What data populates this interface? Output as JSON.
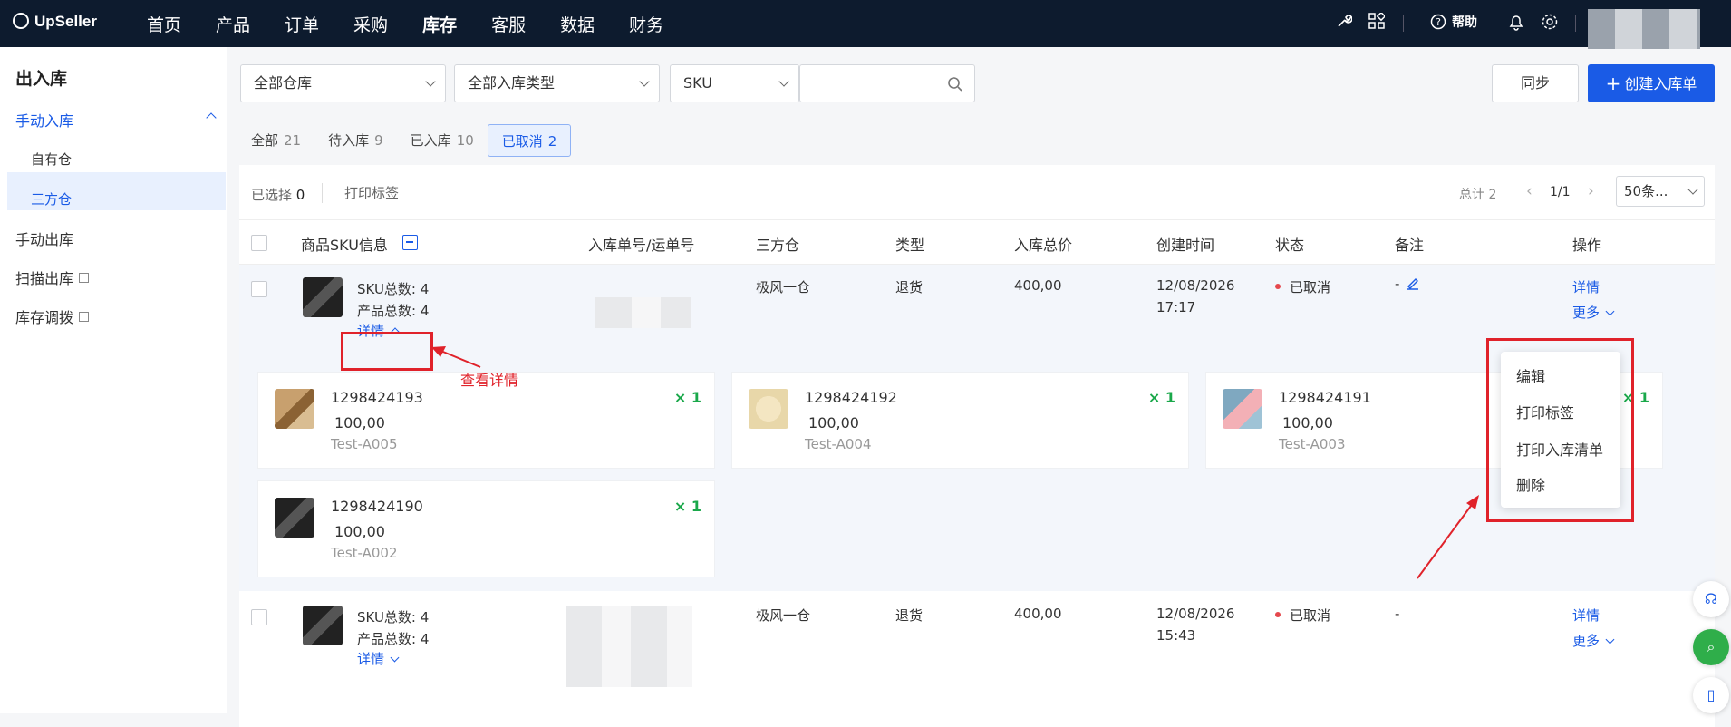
{
  "app": {
    "brand": "UpSeller"
  },
  "nav": {
    "items": [
      "首页",
      "产品",
      "订单",
      "采购",
      "库存",
      "客服",
      "数据",
      "财务"
    ],
    "active": "库存"
  },
  "topbar": {
    "help_label": "帮助"
  },
  "sidebar": {
    "title": "出入库",
    "group_label": "手动入库",
    "sub_items": [
      "自有仓",
      "三方仓"
    ],
    "selected": "三方仓",
    "items": [
      "手动出库",
      "扫描出库",
      "库存调拨"
    ]
  },
  "filters": {
    "warehouse": "全部仓库",
    "inbound_type": "全部入库类型",
    "search_field": "SKU",
    "search_value": ""
  },
  "buttons": {
    "sync": "同步",
    "create": "创建入库单"
  },
  "tabs": [
    {
      "label": "全部",
      "count": "21"
    },
    {
      "label": "待入库",
      "count": "9"
    },
    {
      "label": "已入库",
      "count": "10"
    },
    {
      "label": "已取消",
      "count": "2"
    }
  ],
  "toolbar": {
    "selected_label": "已选择",
    "selected_count": "0",
    "print_label": "打印标签",
    "total_label": "总计 2",
    "page": "1/1",
    "page_size": "50条..."
  },
  "table": {
    "headers": [
      "商品SKU信息",
      "入库单号/运单号",
      "三方仓",
      "类型",
      "入库总价",
      "创建时间",
      "状态",
      "备注",
      "操作"
    ],
    "rows": [
      {
        "sku_count": "SKU总数: 4",
        "product_count": "产品总数: 4",
        "detail_label": "详情",
        "warehouse": "极风一仓",
        "type": "退货",
        "total": "400,00",
        "date": "12/08/2026",
        "time": "17:17",
        "status": "已取消",
        "note": "-",
        "action_detail": "详情",
        "action_more": "更多",
        "items": [
          {
            "sku": "1298424193",
            "price": "100,00",
            "code": "Test-A005",
            "qty": "× 1"
          },
          {
            "sku": "1298424192",
            "price": "100,00",
            "code": "Test-A004",
            "qty": "× 1"
          },
          {
            "sku": "1298424191",
            "price": "100,00",
            "code": "Test-A003",
            "qty": "× 1"
          },
          {
            "sku": "1298424190",
            "price": "100,00",
            "code": "Test-A002",
            "qty": "× 1"
          }
        ]
      },
      {
        "sku_count": "SKU总数: 4",
        "product_count": "产品总数: 4",
        "detail_label": "详情",
        "warehouse": "极风一仓",
        "type": "退货",
        "total": "400,00",
        "date": "12/08/2026",
        "time": "15:43",
        "status": "已取消",
        "note": "-",
        "action_detail": "详情",
        "action_more": "更多"
      }
    ]
  },
  "dropdown": {
    "items": [
      "编辑",
      "打印标签",
      "打印入库清单",
      "删除"
    ]
  },
  "annotation": {
    "text": "查看详情"
  },
  "colors": {
    "accent": "#1a5be6",
    "topbar": "#0d1b2e",
    "annotation": "#e0222a",
    "qty": "#1aa84a"
  }
}
